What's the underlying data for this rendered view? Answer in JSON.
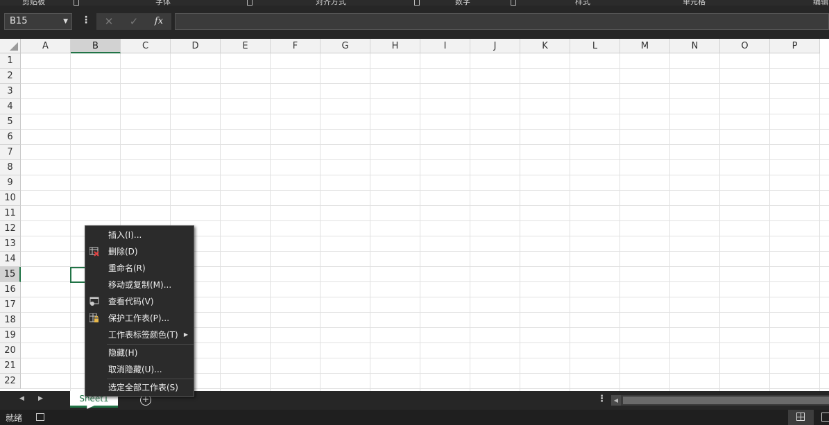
{
  "ribbon": {
    "groups": [
      {
        "label": "剪贴板"
      },
      {
        "label": "字体"
      },
      {
        "label": "对齐方式"
      },
      {
        "label": "数字"
      },
      {
        "label": "样式"
      },
      {
        "label": "单元格"
      },
      {
        "label": "编辑"
      }
    ]
  },
  "formula_bar": {
    "name_box": "B15",
    "cancel_symbol": "✕",
    "enter_symbol": "✓",
    "fx_symbol": "fx",
    "formula_value": ""
  },
  "grid": {
    "columns": [
      "A",
      "B",
      "C",
      "D",
      "E",
      "F",
      "G",
      "H",
      "I",
      "J",
      "K",
      "L",
      "M",
      "N",
      "O",
      "P"
    ],
    "rows": [
      "1",
      "2",
      "3",
      "4",
      "5",
      "6",
      "7",
      "8",
      "9",
      "10",
      "11",
      "12",
      "13",
      "14",
      "15",
      "16",
      "17",
      "18",
      "19",
      "20",
      "21",
      "22"
    ],
    "selected_column": "B",
    "selected_row": "15"
  },
  "sheet_tabs": {
    "prev_arrow": "◀",
    "next_arrow": "▶",
    "tabs": [
      {
        "label": "Sheet1"
      }
    ],
    "add_symbol": "+"
  },
  "status_bar": {
    "status": "就绪"
  },
  "context_menu": {
    "items": [
      {
        "label": "插入(I)...",
        "icon": "none"
      },
      {
        "label": "删除(D)",
        "icon": "delete-sheet-icon"
      },
      {
        "label": "重命名(R)",
        "icon": "none"
      },
      {
        "label": "移动或复制(M)...",
        "icon": "none"
      },
      {
        "label": "查看代码(V)",
        "icon": "view-code-icon"
      },
      {
        "label": "保护工作表(P)...",
        "icon": "protect-sheet-icon"
      },
      {
        "label": "工作表标签颜色(T)",
        "icon": "none",
        "submenu": true
      },
      {
        "label": "隐藏(H)",
        "icon": "none"
      },
      {
        "label": "取消隐藏(U)...",
        "icon": "none"
      },
      {
        "label": "选定全部工作表(S)",
        "icon": "none"
      }
    ]
  },
  "colors": {
    "accent": "#217346",
    "menu_bg": "#2b2b2b",
    "chrome_bg": "#262626"
  }
}
